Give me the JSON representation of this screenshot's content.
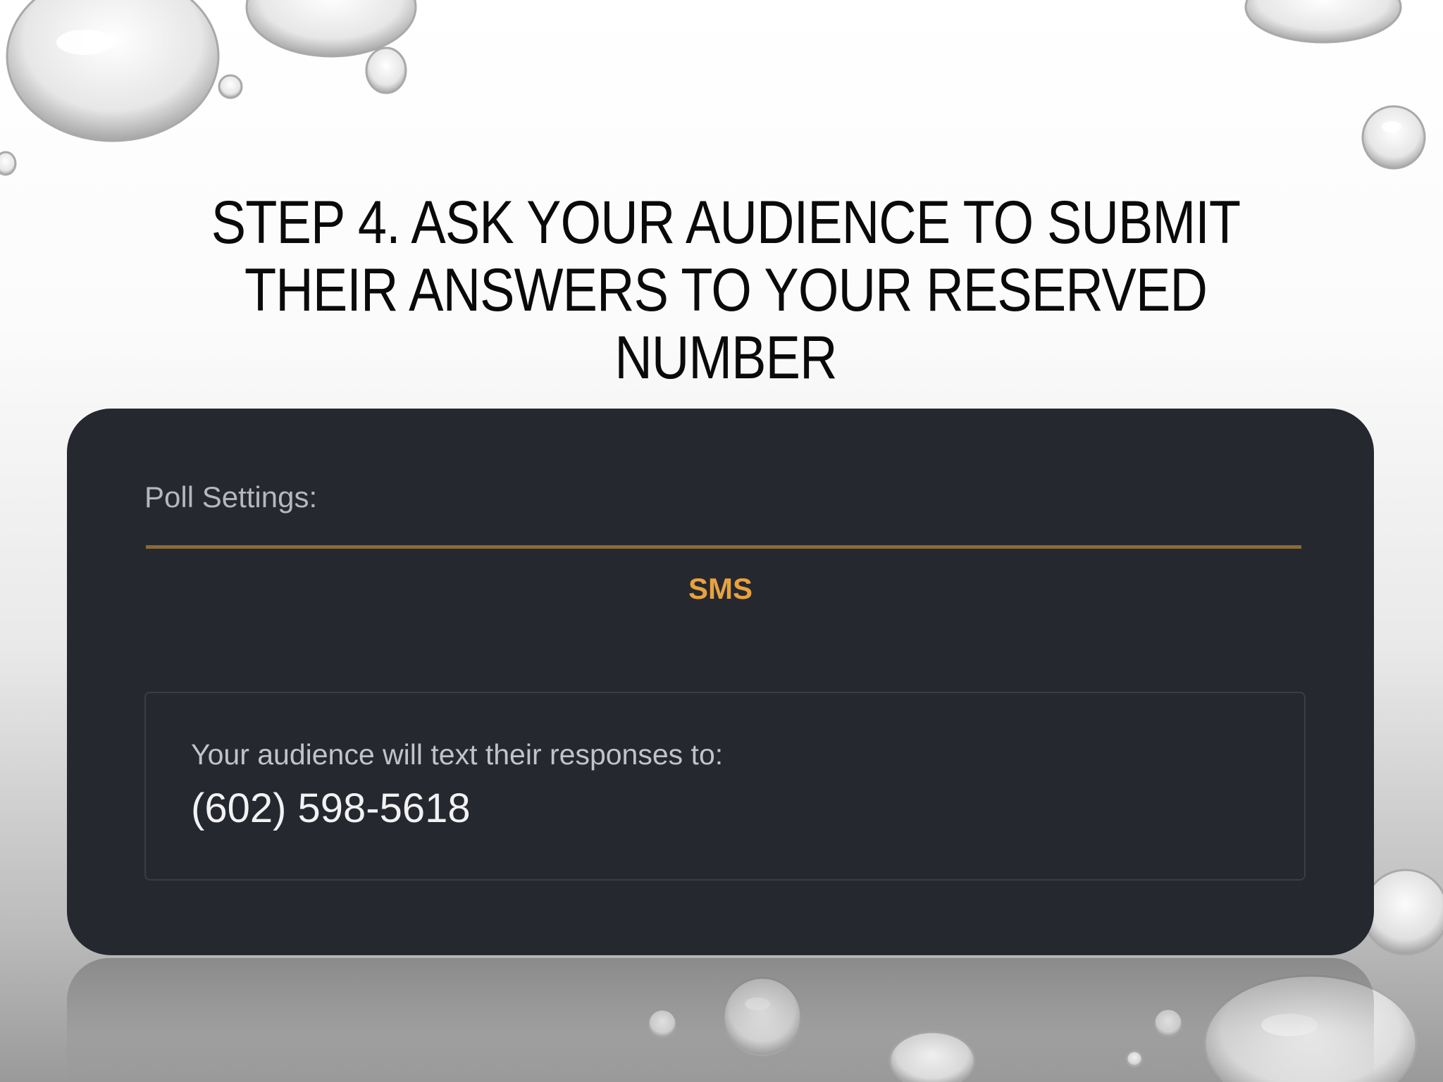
{
  "slide": {
    "title": "STEP 4. ASK YOUR AUDIENCE TO SUBMIT THEIR ANSWERS TO YOUR RESERVED NUMBER"
  },
  "panel": {
    "label": "Poll Settings:",
    "tabs": [
      {
        "label": "SMS",
        "active": true
      }
    ],
    "sms": {
      "caption": "Your audience will text their responses to:",
      "phone_number": "(602) 598-5618"
    }
  },
  "colors": {
    "panel_background": "#26282f",
    "accent": "#e8a23d",
    "tab_underline": "#8a6a38"
  }
}
